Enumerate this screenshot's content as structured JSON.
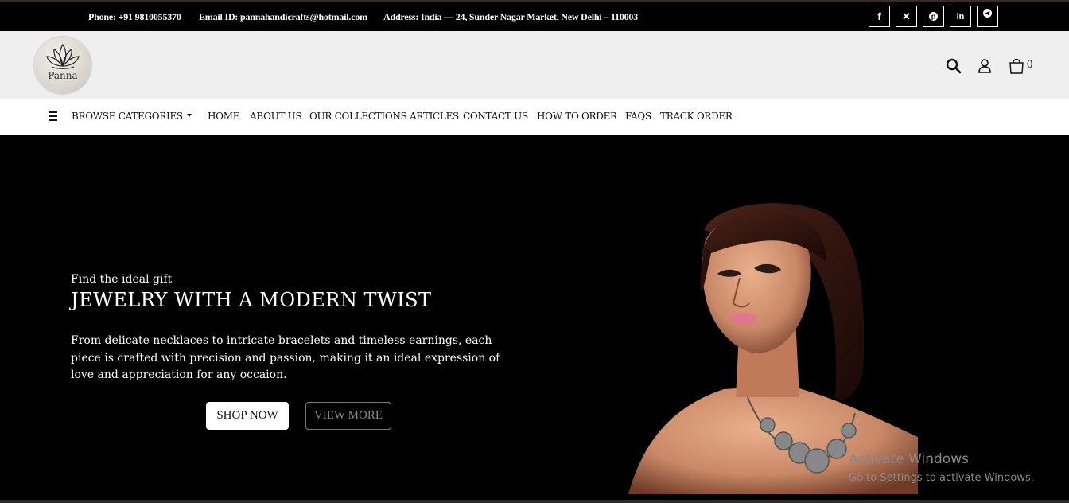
{
  "topbar": {
    "phone": "Phone: +91 9810055370",
    "email": "Email ID: pannahandicrafts@hotmail.com",
    "address": "Address: India — 24, Sunder Nagar Market, New Delhi – 110003",
    "social": [
      {
        "name": "facebook-icon",
        "glyph": "f"
      },
      {
        "name": "x-twitter-icon",
        "glyph": "✕"
      },
      {
        "name": "pinterest-icon",
        "glyph": "℗"
      },
      {
        "name": "linkedin-icon",
        "glyph": "in"
      },
      {
        "name": "telegram-icon",
        "glyph": "➤"
      }
    ]
  },
  "header": {
    "logo_text": "Panna",
    "icons": [
      "search-icon",
      "user-icon",
      "cart-icon"
    ],
    "cart_count": "0"
  },
  "nav": {
    "browse_label": "BROWSE CATEGORIES",
    "items": [
      "HOME",
      "ABOUT US",
      "OUR COLLECTIONS",
      "ARTICLES",
      "CONTACT US",
      "HOW TO ORDER",
      "FAQS",
      "TRACK ORDER"
    ]
  },
  "hero": {
    "tagline": "Find the ideal gift",
    "headline": "JEWELRY WITH A MODERN TWIST",
    "description": "From delicate necklaces to intricate bracelets and timeless earnings, each piece is crafted with precision and passion, making it an ideal expression of love and appreciation for any occaion.",
    "shop_button": "SHOP NOW",
    "view_button": "VIEW MORE"
  },
  "watermark": {
    "line1": "Activate Windows",
    "line2": "Go to Settings to activate Windows."
  },
  "colors": {
    "topbar_bg": "#000000",
    "header_bg": "#efefef",
    "nav_bg": "#ffffff",
    "hero_bg": "#000000"
  }
}
